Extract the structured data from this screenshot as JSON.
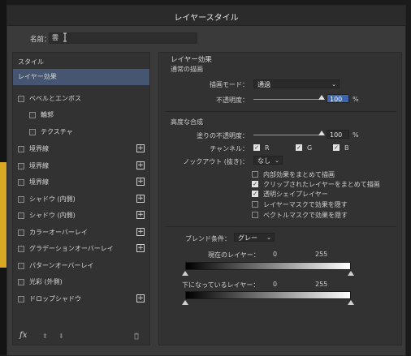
{
  "dialog": {
    "title": "レイヤースタイル",
    "name_label": "名前：",
    "name_value": "雲"
  },
  "left": {
    "header": "スタイル",
    "items": [
      {
        "label": "レイヤー効果"
      },
      {
        "label": "ベベルとエンボス"
      },
      {
        "label": "輪郭"
      },
      {
        "label": "テクスチャ"
      },
      {
        "label": "境界線"
      },
      {
        "label": "境界線"
      },
      {
        "label": "境界線"
      },
      {
        "label": "シャドウ (内側)"
      },
      {
        "label": "シャドウ (内側)"
      },
      {
        "label": "カラーオーバーレイ"
      },
      {
        "label": "グラデーションオーバーレイ"
      },
      {
        "label": "パターンオーバーレイ"
      },
      {
        "label": "光彩 (外側)"
      },
      {
        "label": "ドロップシャドウ"
      }
    ],
    "plus_symbol": "+",
    "footer": {
      "fx": "fx",
      "up": "⬆",
      "down": "⬇",
      "trash": "🗑"
    }
  },
  "right": {
    "section_title": "レイヤー効果",
    "normal_blend_title": "通常の描画",
    "blend_mode_label": "描画モード：",
    "blend_mode_value": "通過",
    "opacity_label": "不透明度：",
    "opacity_value": "100",
    "percent": "%",
    "advanced_title": "高度な合成",
    "fill_opacity_label": "塗りの不透明度：",
    "fill_opacity_value": "100",
    "channels_label": "チャンネル：",
    "channels": {
      "r": "R",
      "g": "G",
      "b": "B"
    },
    "knockout_label": "ノックアウト (抜き)：",
    "knockout_value": "なし",
    "options": [
      {
        "label": "内部効果をまとめて描画",
        "checked": false
      },
      {
        "label": "クリップされたレイヤーをまとめて描画",
        "checked": true
      },
      {
        "label": "透明シェイプレイヤー",
        "checked": true
      },
      {
        "label": "レイヤーマスクで効果を隠す",
        "checked": false
      },
      {
        "label": "ベクトルマスクで効果を隠す",
        "checked": false
      }
    ],
    "blend_if_label": "ブレンド条件：",
    "blend_if_value": "グレー",
    "current_layer_label": "現在のレイヤー：",
    "current_layer_min": "0",
    "current_layer_max": "255",
    "underlying_layer_label": "下になっているレイヤー：",
    "underlying_layer_min": "0",
    "underlying_layer_max": "255"
  },
  "checkmark": "✓",
  "chevron": "⌄"
}
